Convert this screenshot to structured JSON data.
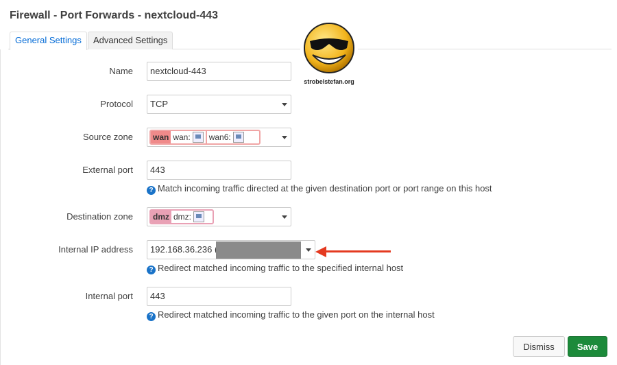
{
  "dialog": {
    "title": "Firewall - Port Forwards - nextcloud-443",
    "tabs": [
      {
        "label": "General Settings",
        "active": true
      },
      {
        "label": "Advanced Settings",
        "active": false
      }
    ]
  },
  "logo": {
    "caption": "strobelstefan.org",
    "icon": "sunglasses-smiley-icon"
  },
  "form": {
    "name": {
      "label": "Name",
      "value": "nextcloud-443"
    },
    "protocol": {
      "label": "Protocol",
      "value": "TCP"
    },
    "source_zone": {
      "label": "Source zone",
      "zone": "wan",
      "subs": [
        "wan:",
        "wan6:"
      ]
    },
    "external_port": {
      "label": "External port",
      "value": "443",
      "help": "Match incoming traffic directed at the given destination port or port range on this host"
    },
    "destination_zone": {
      "label": "Destination zone",
      "zone": "dmz",
      "subs": [
        "dmz:"
      ]
    },
    "internal_ip": {
      "label": "Internal IP address",
      "value": "192.168.36.236 (",
      "help": "Redirect matched incoming traffic to the specified internal host"
    },
    "internal_port": {
      "label": "Internal port",
      "value": "443",
      "help": "Redirect matched incoming traffic to the given port on the internal host"
    }
  },
  "buttons": {
    "dismiss": "Dismiss",
    "save": "Save"
  },
  "colors": {
    "accent": "#0069d6",
    "save": "#1c8a3a",
    "wan": "#f08a8a",
    "dmz": "#e9a1b5",
    "arrow": "#e43a20"
  }
}
